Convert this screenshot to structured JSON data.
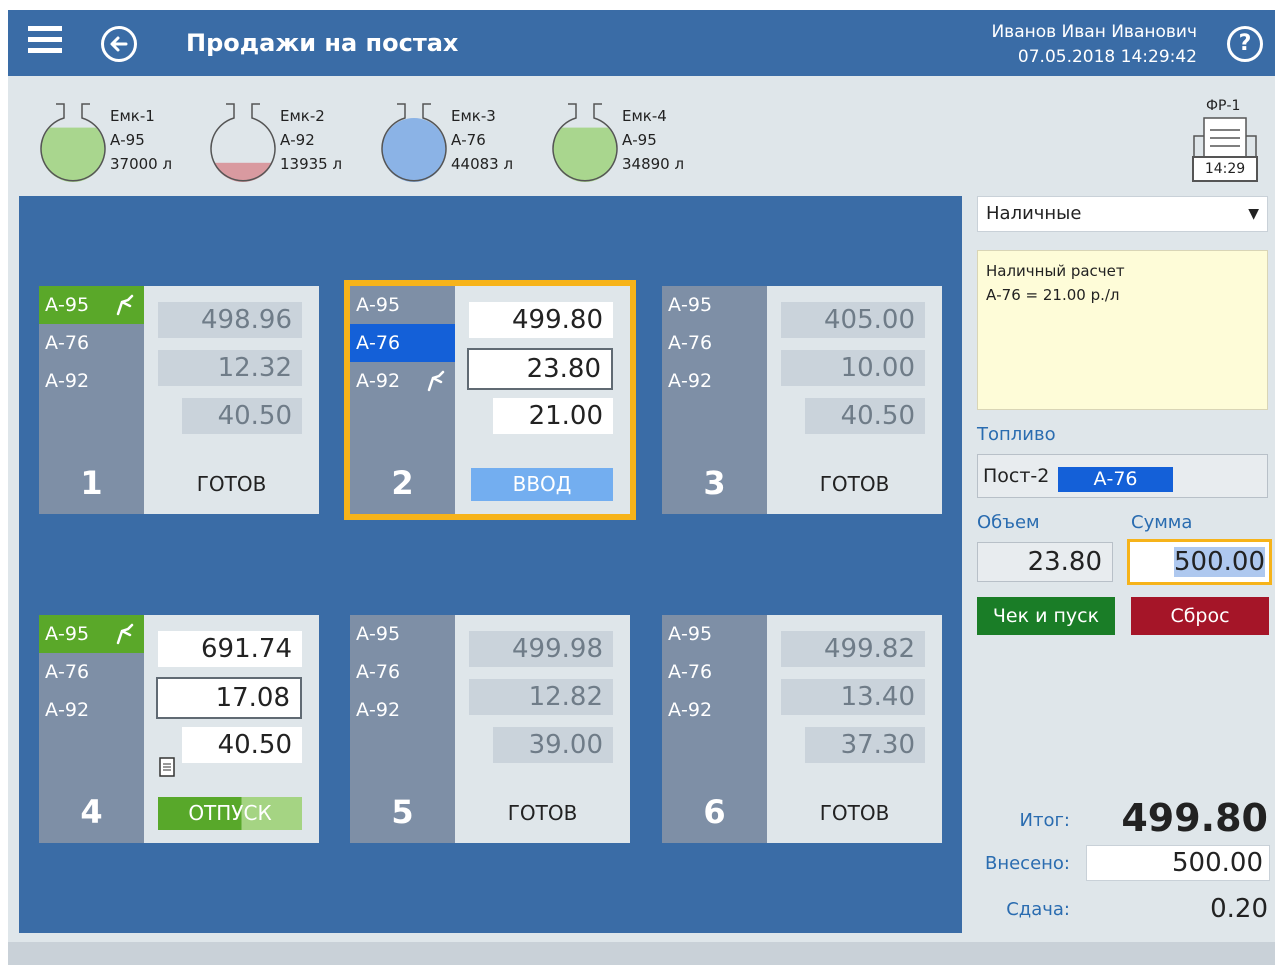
{
  "header": {
    "title": "Продажи на постах",
    "user_name": "Иванов Иван Иванович",
    "datetime": "07.05.2018 14:29:42",
    "help_label": "?"
  },
  "tanks": [
    {
      "name": "Емк-1",
      "fuel": "А-95",
      "volume": "37000 л",
      "level": 0.85,
      "color": "#a9d68e"
    },
    {
      "name": "Емк-2",
      "fuel": "А-92",
      "volume": "13935 л",
      "level": 0.3,
      "color": "#d99aa0"
    },
    {
      "name": "Емк-3",
      "fuel": "А-76",
      "volume": "44083 л",
      "level": 1.0,
      "color": "#8bb3e6"
    },
    {
      "name": "Емк-4",
      "fuel": "А-95",
      "volume": "34890 л",
      "level": 0.85,
      "color": "#a9d68e"
    }
  ],
  "printer": {
    "label": "ФР-1",
    "time": "14:29"
  },
  "posts": [
    {
      "number": "1",
      "fuels": [
        "А-95",
        "А-76",
        "А-92"
      ],
      "values": [
        "498.96",
        "12.32",
        "40.50"
      ],
      "status": "ГОТОВ"
    },
    {
      "number": "2",
      "fuels": [
        "А-95",
        "А-76",
        "А-92"
      ],
      "values": [
        "499.80",
        "23.80",
        "21.00"
      ],
      "button": "ВВОД"
    },
    {
      "number": "3",
      "fuels": [
        "А-95",
        "А-76",
        "А-92"
      ],
      "values": [
        "405.00",
        "10.00",
        "40.50"
      ],
      "status": "ГОТОВ"
    },
    {
      "number": "4",
      "fuels": [
        "А-95",
        "А-76",
        "А-92"
      ],
      "values": [
        "691.74",
        "17.08",
        "40.50"
      ],
      "button": "ОТПУСК",
      "progress": 0.58
    },
    {
      "number": "5",
      "fuels": [
        "А-95",
        "А-76",
        "А-92"
      ],
      "values": [
        "499.98",
        "12.82",
        "39.00"
      ],
      "status": "ГОТОВ"
    },
    {
      "number": "6",
      "fuels": [
        "А-95",
        "А-76",
        "А-92"
      ],
      "values": [
        "499.82",
        "13.40",
        "37.30"
      ],
      "status": "ГОТОВ"
    }
  ],
  "payment": {
    "method": "Наличные",
    "info_line1": "Наличный расчет",
    "info_line2": "А-76 = 21.00 р./л",
    "fuel_label": "Топливо",
    "fuel_post": "Пост-2",
    "fuel_type": "А-76",
    "volume_label": "Объем",
    "sum_label": "Сумма",
    "volume": "23.80",
    "sum": "500.00",
    "check_button": "Чек и пуск",
    "reset_button": "Сброс",
    "total_label": "Итог:",
    "total": "499.80",
    "paid_label": "Внесено:",
    "paid": "500.00",
    "change_label": "Сдача:",
    "change": "0.20"
  },
  "colors": {
    "header": "#3a6ca6",
    "accent_orange": "#f6b31a",
    "green": "#5aa829",
    "blue_selected": "#1460d8",
    "check_green": "#1a7d27",
    "reset_red": "#a51528"
  }
}
